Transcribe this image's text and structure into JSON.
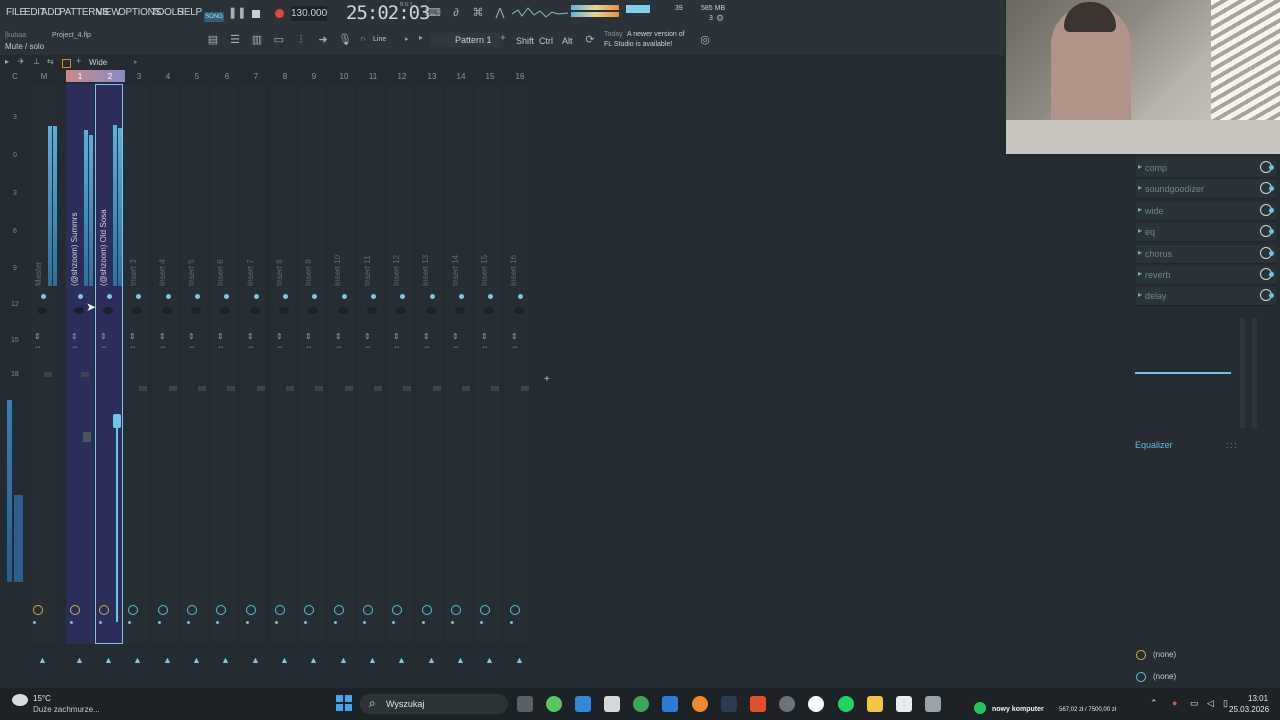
{
  "menu": [
    "FILE",
    "EDIT",
    "ADD",
    "PATTERNS",
    "VIEW",
    "OPTIONS",
    "TOOLS",
    "HELP"
  ],
  "transport": {
    "mode": "SONG",
    "tempo": "130.000",
    "time": "25:02:03",
    "time_unit": "B:S:T",
    "cpu": "39",
    "memory": "585 MB",
    "poly": "3"
  },
  "project": {
    "user": "[kubaa",
    "file": "Project_4.flp",
    "hint": "Mute / solo"
  },
  "toolbar": {
    "snap": "Line",
    "pattern": "Pattern 1",
    "shift": "Shift",
    "ctrl": "Ctrl",
    "alt": "Alt",
    "news_day": "Today",
    "news_line1": "A newer version of",
    "news_line2": "FL Studio is available!"
  },
  "mixer": {
    "view": "Wide",
    "header_labels": [
      "C",
      "M",
      "1",
      "2",
      "3",
      "4",
      "5",
      "6",
      "7",
      "8",
      "9",
      "10",
      "11",
      "12",
      "13",
      "14",
      "15",
      "16"
    ],
    "db_scale": [
      "3",
      "0",
      "3",
      "6",
      "9",
      "12",
      "15",
      "18"
    ],
    "tracks": [
      "Master",
      "(@shzoom) Summrs",
      "(@shzoom) Old Sosa",
      "Insert 3",
      "Insert 4",
      "Insert 5",
      "Insert 6",
      "Insert 7",
      "Insert 8",
      "Insert 9",
      "Insert 10",
      "Insert 11",
      "Insert 12",
      "Insert 13",
      "Insert 14",
      "Insert 15",
      "Insert 16"
    ]
  },
  "effects": {
    "slots": [
      "comp",
      "soundgoodizer",
      "wide",
      "eq",
      "chorus",
      "reverb",
      "delay"
    ],
    "eq_label": "Equalizer",
    "routing_in": "(none)",
    "routing_out": "(none)"
  },
  "taskbar": {
    "weather_temp": "15°C",
    "weather_desc": "Duże zachmurze...",
    "search": "Wyszukaj",
    "notif": "nowy komputer",
    "money": "567,02 zł / 7500,00 zł",
    "clock_time": "13:01",
    "clock_date": "25.03.2026"
  }
}
